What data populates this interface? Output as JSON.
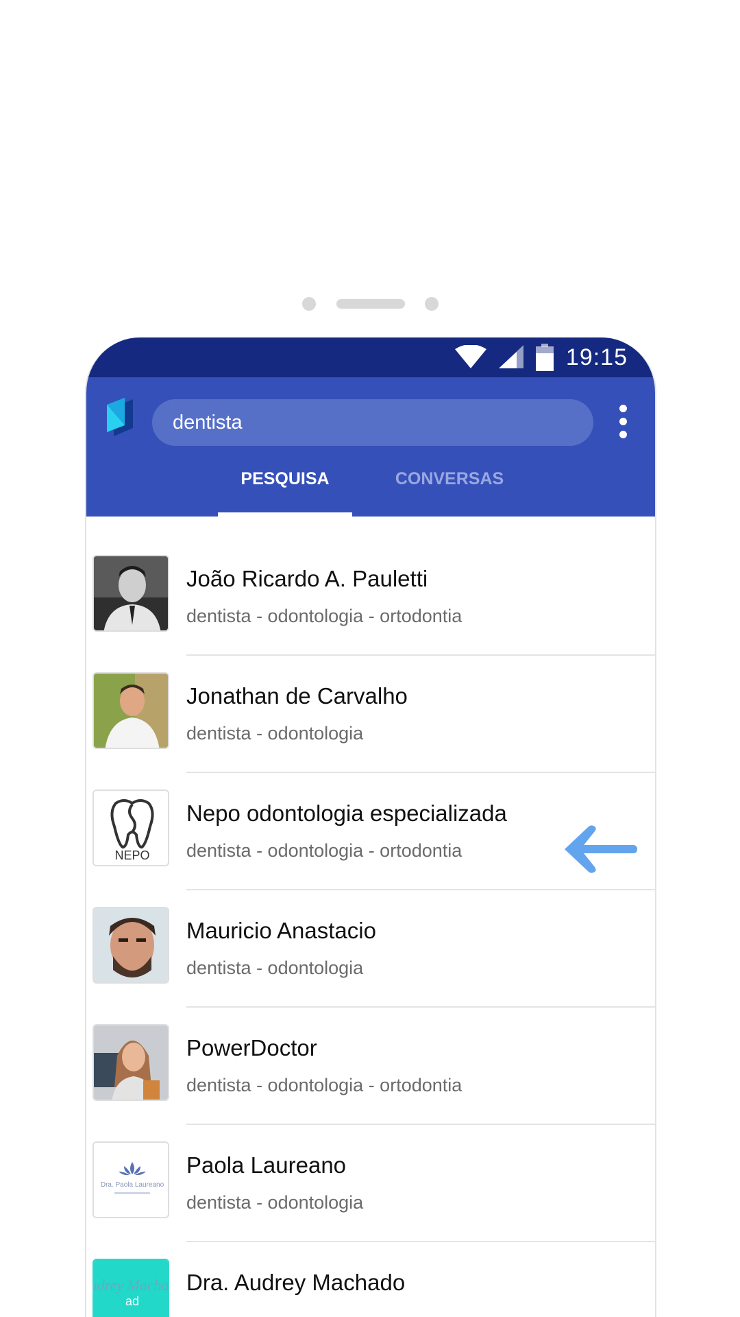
{
  "status_bar": {
    "time": "19:15",
    "icons": [
      "wifi-icon",
      "signal-icon",
      "battery-icon"
    ]
  },
  "app_bar": {
    "search_value": "dentista",
    "tabs": [
      {
        "label": "PESQUISA",
        "active": true
      },
      {
        "label": "CONVERSAS",
        "active": false
      }
    ]
  },
  "results": [
    {
      "name": "João Ricardo A. Pauletti",
      "tags": "dentista - odontologia - ortodontia"
    },
    {
      "name": "Jonathan de Carvalho",
      "tags": "dentista - odontologia"
    },
    {
      "name": "Nepo odontologia especializada",
      "tags": "dentista - odontologia - ortodontia",
      "thumb_text": "NEPO"
    },
    {
      "name": "Mauricio Anastacio",
      "tags": "dentista - odontologia"
    },
    {
      "name": "PowerDoctor",
      "tags": "dentista - odontologia - ortodontia"
    },
    {
      "name": "Paola Laureano",
      "tags": "dentista - odontologia",
      "thumb_text": "Dra. Paola Laureano"
    },
    {
      "name": "Dra. Audrey Machado",
      "tags": "",
      "thumb_text": "Audrey Machado"
    }
  ],
  "colors": {
    "status_bar": "#14297f",
    "app_bar": "#3650b9",
    "search_field": "#5670c8",
    "arrow": "#63a4ee"
  }
}
